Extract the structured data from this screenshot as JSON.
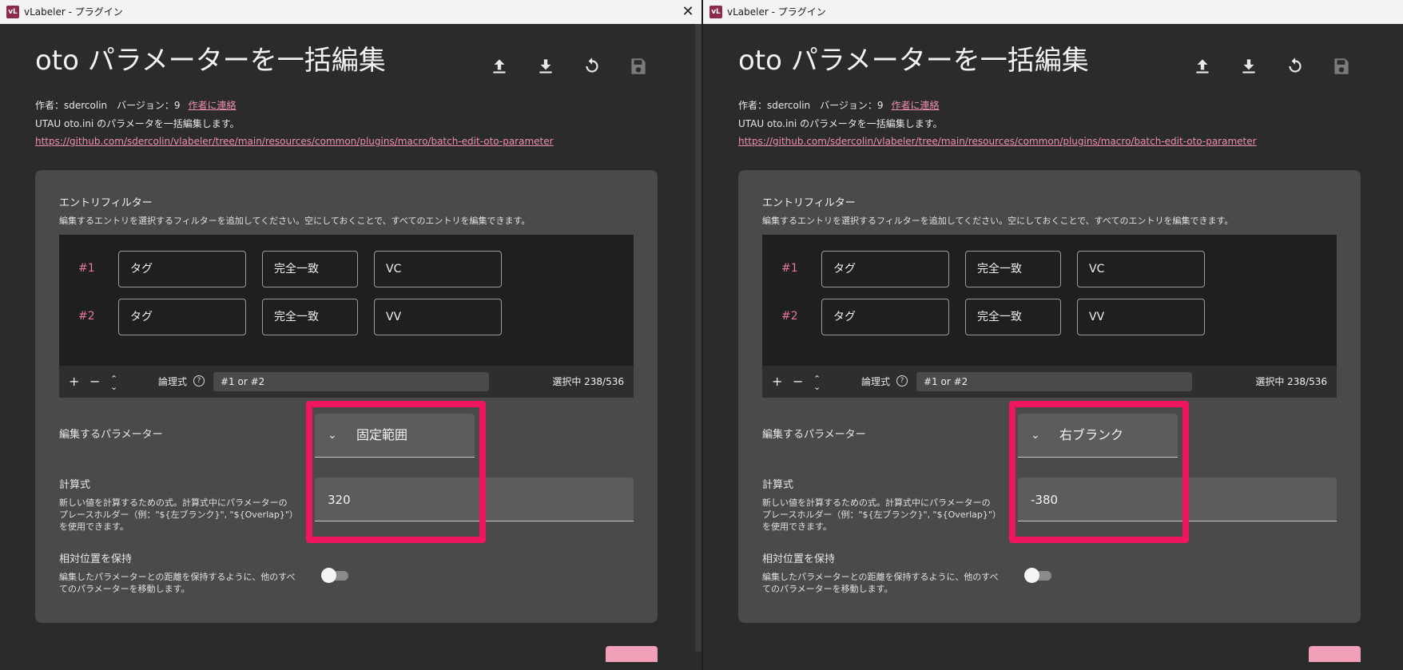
{
  "colors": {
    "accent_pink": "#ee8fae",
    "highlight": "#f0155f",
    "panel": "#4a4a4a",
    "window_bg": "#2b2b2b"
  },
  "windows": [
    {
      "title": "vLabeler - プラグイン",
      "icon_text": "vL",
      "heading": "oto パラメーターを一括編集",
      "actions": [
        "upload-icon",
        "download-icon",
        "reset-icon",
        "save-icon"
      ],
      "author_line": "作者：sdercolin　バージョン：9",
      "author_link": "作者に連絡",
      "description": "UTAU oto.ini のパラメータを一括編集します。",
      "url": "https://github.com/sdercolin/vlabeler/tree/main/resources/common/plugins/macro/batch-edit-oto-parameter",
      "filter": {
        "title": "エントリフィルター",
        "subtitle": "編集するエントリを選択するフィルターを追加してください。空にしておくことで、すべてのエントリを編集できます。",
        "rows": [
          {
            "index": "#1",
            "field": "タグ",
            "match": "完全一致",
            "value": "VC"
          },
          {
            "index": "#2",
            "field": "タグ",
            "match": "完全一致",
            "value": "VV"
          }
        ],
        "toolbar": {
          "add": "+",
          "remove": "−",
          "move": "⌃⌄",
          "logic_label": "論理式",
          "help": "?",
          "logic_value": "#1 or #2",
          "selected": "選択中 238/536"
        }
      },
      "param": {
        "label": "編集するパラメーター",
        "selected": "固定範囲"
      },
      "expression": {
        "title": "計算式",
        "description": "新しい値を計算するための式。計算式中にパラメーターのプレースホルダー（例：\"${左ブランク}\", \"${Overlap}\"）を使用できます。",
        "value": "320"
      },
      "relative": {
        "title": "相対位置を保持",
        "description": "編集したパラメーターとの距離を保持するように、他のすべてのパラメーターを移動します。",
        "enabled": false
      }
    },
    {
      "title": "vLabeler - プラグイン",
      "icon_text": "vL",
      "heading": "oto パラメーターを一括編集",
      "actions": [
        "upload-icon",
        "download-icon",
        "reset-icon",
        "save-icon"
      ],
      "author_line": "作者：sdercolin　バージョン：9",
      "author_link": "作者に連絡",
      "description": "UTAU oto.ini のパラメータを一括編集します。",
      "url": "https://github.com/sdercolin/vlabeler/tree/main/resources/common/plugins/macro/batch-edit-oto-parameter",
      "filter": {
        "title": "エントリフィルター",
        "subtitle": "編集するエントリを選択するフィルターを追加してください。空にしておくことで、すべてのエントリを編集できます。",
        "rows": [
          {
            "index": "#1",
            "field": "タグ",
            "match": "完全一致",
            "value": "VC"
          },
          {
            "index": "#2",
            "field": "タグ",
            "match": "完全一致",
            "value": "VV"
          }
        ],
        "toolbar": {
          "add": "+",
          "remove": "−",
          "move": "⌃⌄",
          "logic_label": "論理式",
          "help": "?",
          "logic_value": "#1 or #2",
          "selected": "選択中 238/536"
        }
      },
      "param": {
        "label": "編集するパラメーター",
        "selected": "右ブランク"
      },
      "expression": {
        "title": "計算式",
        "description": "新しい値を計算するための式。計算式中にパラメーターのプレースホルダー（例：\"${左ブランク}\", \"${Overlap}\"）を使用できます。",
        "value": "-380"
      },
      "relative": {
        "title": "相対位置を保持",
        "description": "編集したパラメーターとの距離を保持するように、他のすべてのパラメーターを移動します。",
        "enabled": false
      }
    }
  ]
}
